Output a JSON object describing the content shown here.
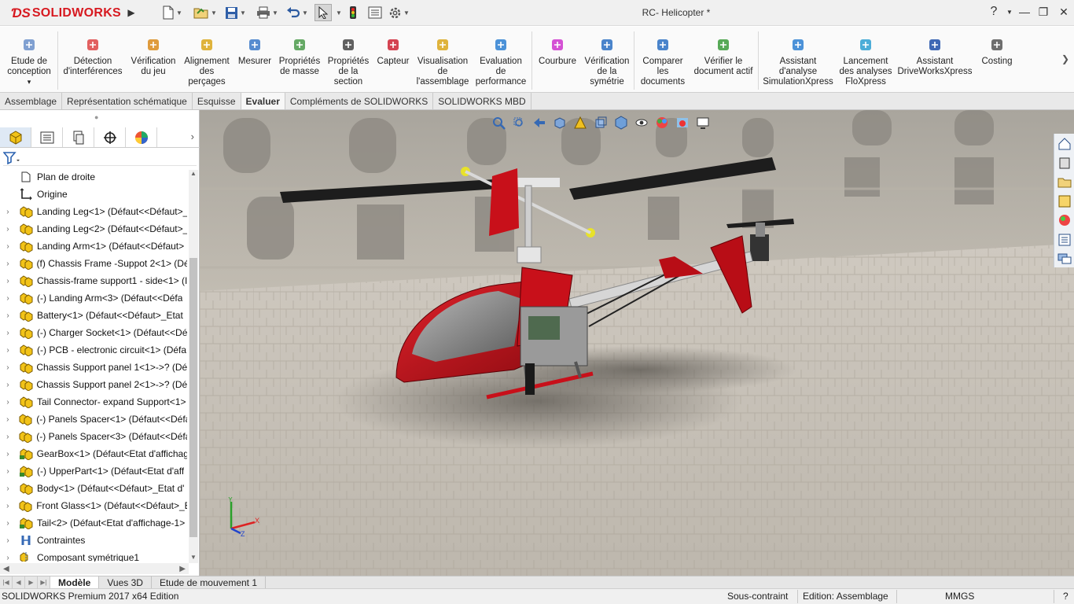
{
  "app": {
    "logo_text": "SOLIDWORKS",
    "window_title": "RC- Helicopter *"
  },
  "titlebar": {
    "help": "?",
    "minimize": "—",
    "restore": "❐",
    "close": "✕"
  },
  "ribbon": {
    "buttons": [
      {
        "label": "Etude de\nconception",
        "icon": "design-study-icon"
      },
      {
        "label": "Détection\nd'interférences",
        "icon": "interference-detection-icon"
      },
      {
        "label": "Vérification\ndu jeu",
        "icon": "clearance-verification-icon"
      },
      {
        "label": "Alignement\ndes\nperçages",
        "icon": "hole-alignment-icon"
      },
      {
        "label": "Mesurer",
        "icon": "measure-icon"
      },
      {
        "label": "Propriétés\nde masse",
        "icon": "mass-properties-icon"
      },
      {
        "label": "Propriétés\nde la\nsection",
        "icon": "section-properties-icon"
      },
      {
        "label": "Capteur",
        "icon": "sensor-icon"
      },
      {
        "label": "Visualisation\nde\nl'assemblage",
        "icon": "assembly-visualization-icon"
      },
      {
        "label": "Evaluation\nde\nperformance",
        "icon": "performance-evaluation-icon"
      },
      {
        "label": "Courbure",
        "icon": "curvature-icon"
      },
      {
        "label": "Vérification\nde la\nsymétrie",
        "icon": "symmetry-check-icon"
      },
      {
        "label": "Comparer\nles\ndocuments",
        "icon": "compare-documents-icon"
      },
      {
        "label": "Vérifier le\ndocument actif",
        "icon": "check-active-document-icon"
      },
      {
        "label": "Assistant\nd'analyse\nSimulationXpress",
        "icon": "simulationxpress-icon"
      },
      {
        "label": "Lancement\ndes analyses\nFloXpress",
        "icon": "floxpress-icon"
      },
      {
        "label": "Assistant\nDriveWorksXpress",
        "icon": "driveworksxpress-icon"
      },
      {
        "label": "Costing",
        "icon": "costing-icon"
      }
    ]
  },
  "command_tabs": [
    {
      "label": "Assemblage",
      "active": false
    },
    {
      "label": "Représentation schématique",
      "active": false
    },
    {
      "label": "Esquisse",
      "active": false
    },
    {
      "label": "Evaluer",
      "active": true
    },
    {
      "label": "Compléments de SOLIDWORKS",
      "active": false
    },
    {
      "label": "SOLIDWORKS MBD",
      "active": false
    }
  ],
  "feature_tree": {
    "items": [
      {
        "label": "Plan de droite",
        "icon": "plane-icon",
        "expandable": false
      },
      {
        "label": "Origine",
        "icon": "origin-icon",
        "expandable": false
      },
      {
        "label": "Landing Leg<1> (Défaut<<Défaut>_",
        "icon": "part-icon",
        "expandable": true
      },
      {
        "label": "Landing Leg<2> (Défaut<<Défaut>_",
        "icon": "part-icon",
        "expandable": true
      },
      {
        "label": "Landing Arm<1> (Défaut<<Défaut>",
        "icon": "part-icon",
        "expandable": true
      },
      {
        "label": "(f) Chassis Frame -Suppot 2<1> (Dé",
        "icon": "part-icon",
        "expandable": true
      },
      {
        "label": "Chassis-frame support1 - side<1> (I",
        "icon": "part-icon",
        "expandable": true
      },
      {
        "label": "(-) Landing Arm<3> (Défaut<<Défa",
        "icon": "part-icon",
        "expandable": true
      },
      {
        "label": "Battery<1> (Défaut<<Défaut>_Etat",
        "icon": "part-icon",
        "expandable": true
      },
      {
        "label": "(-) Charger Socket<1> (Défaut<<Dé",
        "icon": "part-icon",
        "expandable": true
      },
      {
        "label": "(-) PCB -  electronic circuit<1> (Défa",
        "icon": "part-icon",
        "expandable": true
      },
      {
        "label": "Chassis Support panel 1<1>->? (Déf",
        "icon": "part-icon",
        "expandable": true
      },
      {
        "label": "Chassis Support panel 2<1>->? (Déf",
        "icon": "part-icon",
        "expandable": true
      },
      {
        "label": "Tail Connector- expand Support<1>",
        "icon": "part-icon",
        "expandable": true
      },
      {
        "label": "(-) Panels Spacer<1> (Défaut<<Défa",
        "icon": "part-icon",
        "expandable": true
      },
      {
        "label": "(-) Panels Spacer<3> (Défaut<<Défa",
        "icon": "part-icon",
        "expandable": true
      },
      {
        "label": "GearBox<1> (Défaut<Etat d'affichag",
        "icon": "subassembly-icon",
        "expandable": true
      },
      {
        "label": "(-) UpperPart<1> (Défaut<Etat d'aff",
        "icon": "subassembly-icon",
        "expandable": true
      },
      {
        "label": "Body<1> (Défaut<<Défaut>_Etat d'",
        "icon": "part-icon",
        "expandable": true
      },
      {
        "label": "Front Glass<1> (Défaut<<Défaut>_E",
        "icon": "part-icon",
        "expandable": true
      },
      {
        "label": "Tail<2> (Défaut<Etat d'affichage-1>",
        "icon": "subassembly-icon",
        "expandable": true
      },
      {
        "label": "Contraintes",
        "icon": "mates-icon",
        "expandable": true
      },
      {
        "label": "Composant symétrique1",
        "icon": "mirror-component-icon",
        "expandable": true
      }
    ]
  },
  "bottom_tabs": [
    {
      "label": "Modèle",
      "active": true
    },
    {
      "label": "Vues 3D",
      "active": false
    },
    {
      "label": "Etude de mouvement 1",
      "active": false
    }
  ],
  "status": {
    "edition": "SOLIDWORKS Premium 2017 x64 Edition",
    "constraint": "Sous-contraint",
    "mode": "Edition: Assemblage",
    "units": "MMGS",
    "help": "?"
  },
  "colors": {
    "brand_red": "#d71920",
    "helicopter_red": "#c8101a",
    "active_tab": "#f7f7f7"
  }
}
